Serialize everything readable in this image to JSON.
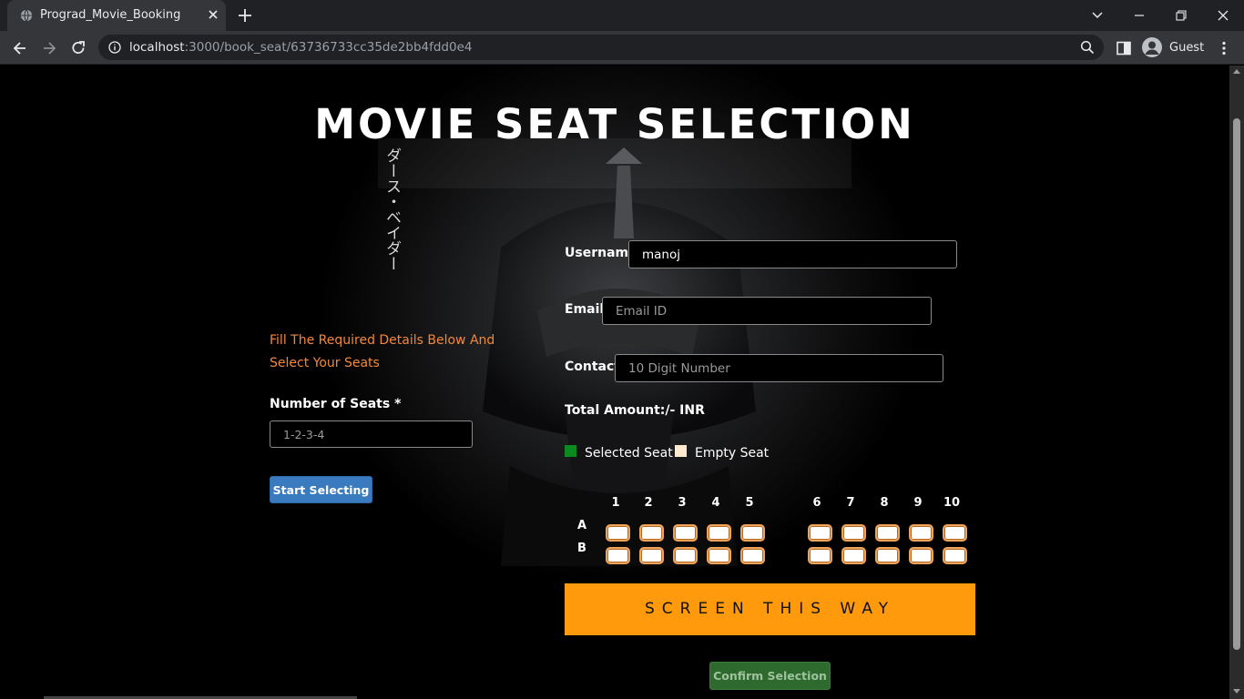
{
  "browser": {
    "tab_title": "Prograd_Movie_Booking",
    "url_host": "localhost",
    "url_path": ":3000/book_seat/63736733cc35de2bb4fdd0e4",
    "profile_label": "Guest",
    "icons": [
      "globe-icon",
      "close-icon",
      "plus-icon",
      "chevron-down-icon",
      "minimize-icon",
      "restore-icon",
      "close-icon",
      "back-arrow-icon",
      "forward-arrow-icon",
      "reload-icon",
      "info-icon",
      "zoom-icon",
      "side-panel-icon",
      "profile-icon",
      "kebab-menu-icon"
    ]
  },
  "page": {
    "title": "MOVIE SEAT SELECTION",
    "katakana": "ダース・ベイダー",
    "intro": "Fill The Required Details Below And Select Your Seats",
    "seats_label": "Number of Seats *",
    "seats_placeholder": "1-2-3-4",
    "start_button": "Start Selecting"
  },
  "form": {
    "username_label": "Username:",
    "username_value": "manoj",
    "email_label": "Email:",
    "email_placeholder": "Email ID",
    "contact_label": "Contact:",
    "contact_placeholder": "10 Digit Number",
    "total_label": "Total Amount:/- INR"
  },
  "legend": {
    "selected_label": "Selected Seat",
    "empty_label": "Empty Seat",
    "selected_color": "#0a8a1f",
    "empty_color": "#ffe9cf"
  },
  "seat_map": {
    "columns": [
      "1",
      "2",
      "3",
      "4",
      "5",
      "6",
      "7",
      "8",
      "9",
      "10"
    ],
    "rows": [
      "A",
      "B"
    ],
    "seat_border_color": "#f1a35a"
  },
  "screen_label": "SCREEN THIS WAY",
  "screen_color": "#ff9a0c",
  "confirm_button": "Confirm Selection"
}
